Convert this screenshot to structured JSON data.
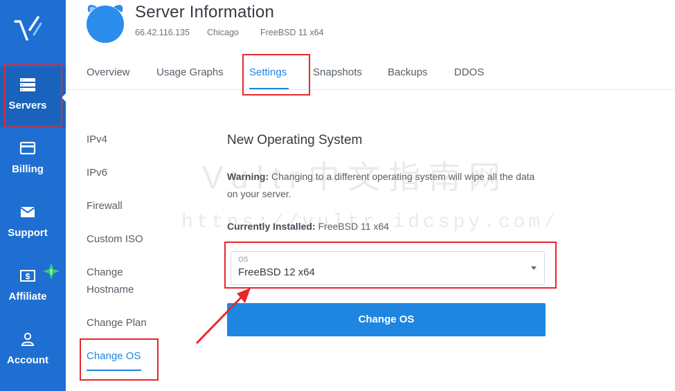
{
  "sidebar": {
    "logo_icon": "vultr-logo-icon",
    "items": [
      {
        "label": "Servers",
        "icon": "server-stack-icon"
      },
      {
        "label": "Billing",
        "icon": "credit-card-icon"
      },
      {
        "label": "Support",
        "icon": "envelope-icon"
      },
      {
        "label": "Affiliate",
        "icon": "dollar-bill-icon",
        "badge": "!"
      },
      {
        "label": "Account",
        "icon": "user-icon"
      }
    ]
  },
  "header": {
    "title": "Server Information",
    "ip": "66.42.116.135",
    "location": "Chicago",
    "os": "FreeBSD 11 x64"
  },
  "tabs": [
    {
      "label": "Overview"
    },
    {
      "label": "Usage Graphs"
    },
    {
      "label": "Settings",
      "active": true
    },
    {
      "label": "Snapshots"
    },
    {
      "label": "Backups"
    },
    {
      "label": "DDOS"
    }
  ],
  "settings_menu": [
    {
      "label": "IPv4"
    },
    {
      "label": "IPv6"
    },
    {
      "label": "Firewall"
    },
    {
      "label": "Custom ISO"
    },
    {
      "label": "Change Hostname"
    },
    {
      "label": "Change Plan"
    },
    {
      "label": "Change OS",
      "active": true
    }
  ],
  "panel": {
    "heading": "New Operating System",
    "warning_label": "Warning:",
    "warning_text": " Changing to a different operating system will wipe all the data on your server.",
    "installed_label": "Currently Installed:",
    "installed_value": " FreeBSD 11 x64",
    "select_label": "OS",
    "select_value": "FreeBSD 12 x64",
    "button_label": "Change OS"
  },
  "watermark": {
    "line1": "Vultr中文指南网",
    "line2": "https://vultr.idcspy.com/"
  },
  "colors": {
    "sidebar": "#1e6fd1",
    "accent": "#1e86e0",
    "annotation": "#e8262b",
    "badge": "#3ecf6e"
  }
}
